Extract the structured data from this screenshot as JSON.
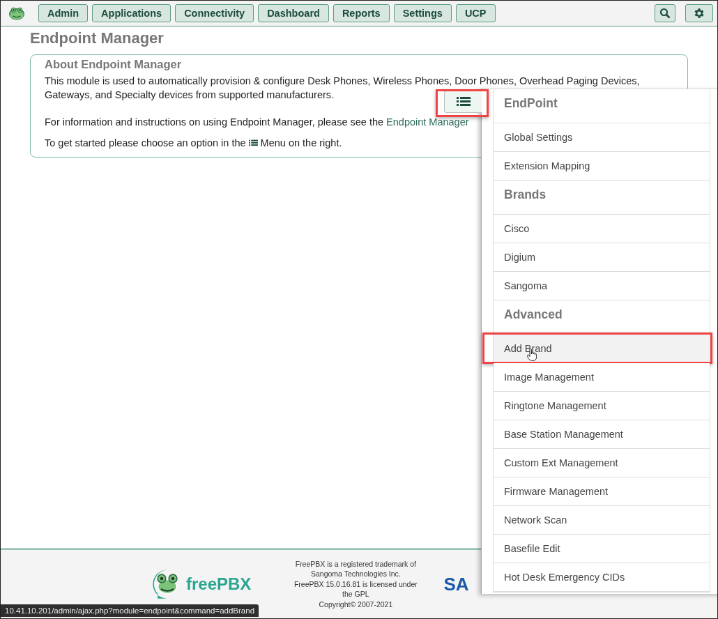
{
  "nav": {
    "tabs": [
      {
        "label": "Admin"
      },
      {
        "label": "Applications"
      },
      {
        "label": "Connectivity"
      },
      {
        "label": "Dashboard"
      },
      {
        "label": "Reports"
      },
      {
        "label": "Settings"
      },
      {
        "label": "UCP"
      }
    ]
  },
  "page_title": "Endpoint Manager",
  "about": {
    "title": "About Endpoint Manager",
    "paragraph_1_lines": [
      "This module is used to automatically provision & configure Desk Phones, Wireless Phones, Door Phones, Overhead Paging Devices,",
      "Gateways, and Specialty devices from supported manufacturers."
    ],
    "paragraph_2": "For information and instructions on using Endpoint Manager, please see the ",
    "paragraph_2_link": "Endpoint Manager",
    "paragraph_3_before": "To get started please choose an option in the",
    "paragraph_3_after": "Menu on the right."
  },
  "menu_toggle": {
    "annotated": true
  },
  "menu": [
    {
      "kind": "header",
      "label": "EndPoint"
    },
    {
      "kind": "item",
      "label": "Global Settings",
      "hovered": false,
      "annotated": false
    },
    {
      "kind": "item",
      "label": "Extension Mapping",
      "hovered": false,
      "annotated": false
    },
    {
      "kind": "header",
      "label": "Brands"
    },
    {
      "kind": "item",
      "label": "Cisco",
      "hovered": false,
      "annotated": false
    },
    {
      "kind": "item",
      "label": "Digium",
      "hovered": false,
      "annotated": false
    },
    {
      "kind": "item",
      "label": "Sangoma",
      "hovered": false,
      "annotated": false
    },
    {
      "kind": "header",
      "label": "Advanced"
    },
    {
      "kind": "item",
      "label": "Add Brand",
      "hovered": true,
      "annotated": true
    },
    {
      "kind": "item",
      "label": "Image Management",
      "hovered": false,
      "annotated": false
    },
    {
      "kind": "item",
      "label": "Ringtone Management",
      "hovered": false,
      "annotated": false
    },
    {
      "kind": "item",
      "label": "Base Station Management",
      "hovered": false,
      "annotated": false
    },
    {
      "kind": "item",
      "label": "Custom Ext Management",
      "hovered": false,
      "annotated": false
    },
    {
      "kind": "item",
      "label": "Firmware Management",
      "hovered": false,
      "annotated": false
    },
    {
      "kind": "item",
      "label": "Network Scan",
      "hovered": false,
      "annotated": false
    },
    {
      "kind": "item",
      "label": "Basefile Edit",
      "hovered": false,
      "annotated": false
    },
    {
      "kind": "item",
      "label": "Hot Desk Emergency CIDs",
      "hovered": false,
      "annotated": false
    }
  ],
  "footer": {
    "logo_text": "freePBX",
    "lines": [
      "FreePBX is a registered trademark of Sangoma Technologies Inc.",
      "FreePBX 15.0.16.81 is licensed under the GPL",
      "Copyright© 2007-2021"
    ],
    "partner_logo_text": "SA"
  },
  "status_url": "10.41.10.201/admin/ajax.php?module=endpoint&command=addBrand"
}
